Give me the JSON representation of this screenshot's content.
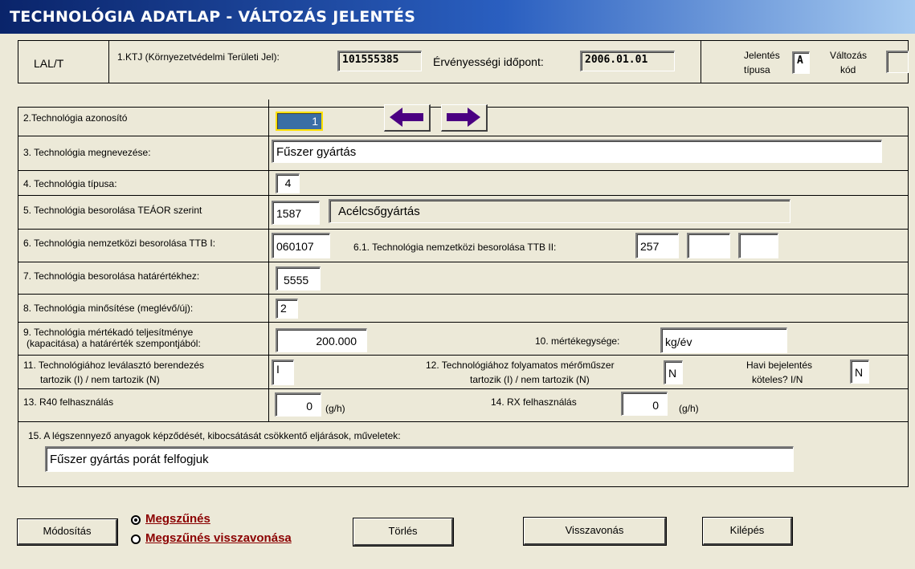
{
  "window": {
    "title": "TECHNOLÓGIA ADATLAP - VÁLTOZÁS JELENTÉS"
  },
  "header": {
    "form_code": "LAL/T",
    "ktj_label": "1.KTJ (Környezetvédelmi Területi Jel):",
    "ktj_value": "101555385",
    "validity_label": "Érvényességi időpont:",
    "validity_value": "2006.01.01",
    "report_type_label_1": "Jelentés",
    "report_type_label_2": "típusa",
    "report_type_value": "A",
    "change_code_label_1": "Változás",
    "change_code_label_2": "kód",
    "change_code_value": ""
  },
  "form": {
    "f2_label": "2.Technológia azonosító",
    "f2_value": "1",
    "f3_label": "3. Technológia  megnevezése:",
    "f3_value": "Fűszer gyártás",
    "f4_label": "4. Technológia típusa:",
    "f4_value": "4",
    "f5_label": "5. Technológia  besorolása TEÁOR szerint",
    "f5_code": "1587",
    "f5_name": "Acélcsőgyártás",
    "f6_label": "6. Technológia  nemzetközi besorolása TTB I:",
    "f6_value": "060107",
    "f61_label": "6.1. Technológia  nemzetközi besorolása TTB II:",
    "f61_value1": "257",
    "f61_value2": "",
    "f61_value3": "",
    "f7_label": "7. Technológia besorolása határértékhez:",
    "f7_value": "5555",
    "f8_label": "8. Technológia  minősítése (meglévő/új):",
    "f8_value": "2",
    "f9_label_1": "9. Technológia  mértékadó teljesítménye",
    "f9_label_2": "(kapacitása) a határérték szempontjából:",
    "f9_value": "200.000",
    "f10_label": "10. mértékegysége:",
    "f10_value": "kg/év",
    "f11_label_1": "11. Technológiához leválasztó berendezés",
    "f11_label_2": "tartozik (I) / nem tartozik  (N)",
    "f11_value": "I",
    "f12_label_1": "12. Technológiához folyamatos mérőműszer",
    "f12_label_2": "tartozik (I) / nem tartozik  (N)",
    "f12_value": "N",
    "monthly_label_1": "Havi bejelentés",
    "monthly_label_2": "köteles? I/N",
    "monthly_value": "N",
    "f13_label": "13. R40 felhasználás",
    "f13_value": "0",
    "f13_unit": "(g/h)",
    "f14_label": "14. RX felhasználás",
    "f14_value": "0",
    "f14_unit": "(g/h)",
    "f15_label": "15. A légszennyező anyagok képződését, kibocsátását csökkentő eljárások, műveletek:",
    "f15_value": "Fűszer gyártás porát felfogjuk"
  },
  "buttons": {
    "modify": "Módosítás",
    "delete": "Törlés",
    "revoke": "Visszavonás",
    "exit": "Kilépés"
  },
  "radios": {
    "termination": "Megszűnés",
    "termination_revoke": "Megszűnés visszavonása",
    "selected": "termination"
  },
  "colors": {
    "arrow": "#4b0082",
    "radio_text": "#8b0000",
    "title_bg": "#0a246a"
  }
}
